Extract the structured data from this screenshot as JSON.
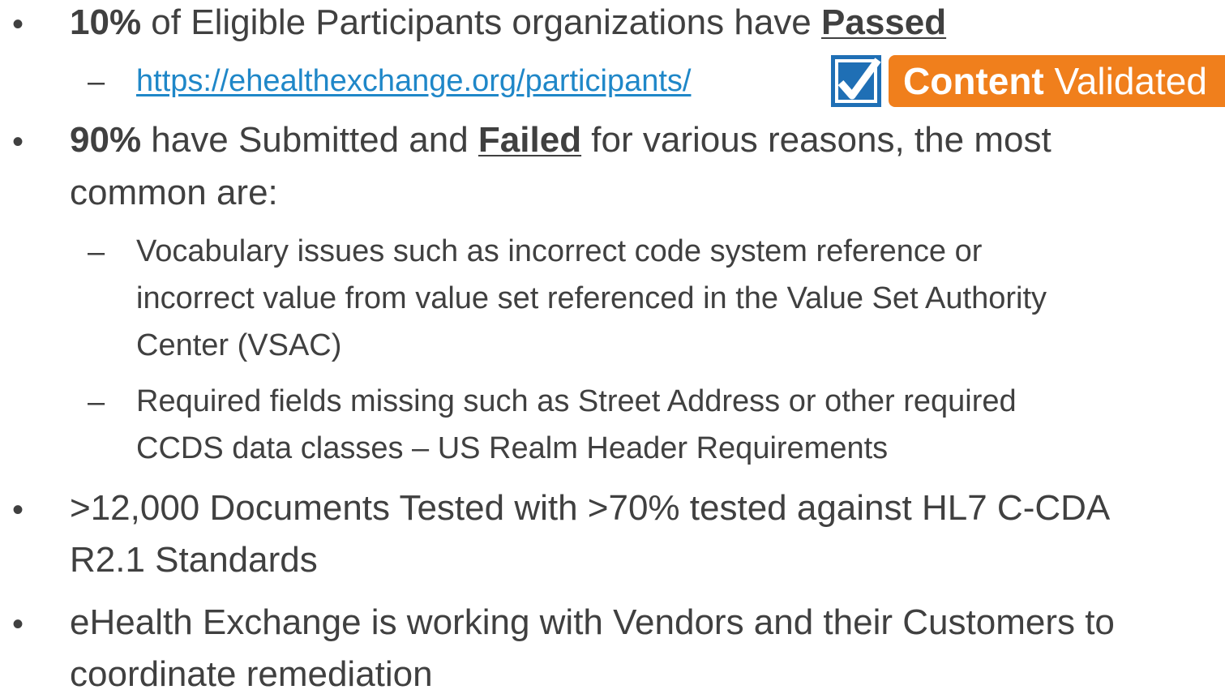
{
  "bullets": [
    {
      "pct": "10%",
      "text": " of Eligible Participants organizations have ",
      "status": "Passed",
      "sub": {
        "link": "https://ehealthexchange.org/participants/",
        "badge": {
          "word1": "Content",
          "word2": "Validated",
          "icon": "check-icon"
        }
      }
    },
    {
      "pct": "90%",
      "text_before": " have Submitted and ",
      "status": "Failed",
      "text_after": " for various reasons, the most",
      "line2": "common are:",
      "subs": [
        {
          "lines": [
            "Vocabulary issues such as incorrect code system reference or",
            "incorrect value from value set referenced in the Value Set Authority",
            "Center (VSAC)"
          ]
        },
        {
          "lines": [
            "Required fields missing such as Street Address or other required",
            "CCDS data classes – US Realm Header Requirements"
          ]
        }
      ]
    },
    {
      "lines": [
        ">12,000 Documents Tested with >70% tested against HL7 C-CDA",
        "R2.1 Standards"
      ]
    },
    {
      "lines": [
        "eHealth Exchange is working with Vendors and their Customers to",
        "coordinate remediation"
      ]
    }
  ],
  "symbols": {
    "bullet": "•",
    "dash": "–"
  },
  "colors": {
    "text": "#404040",
    "link": "#1f87c8",
    "badge_orange": "#f07f1c",
    "badge_blue": "#1f6fb5"
  }
}
